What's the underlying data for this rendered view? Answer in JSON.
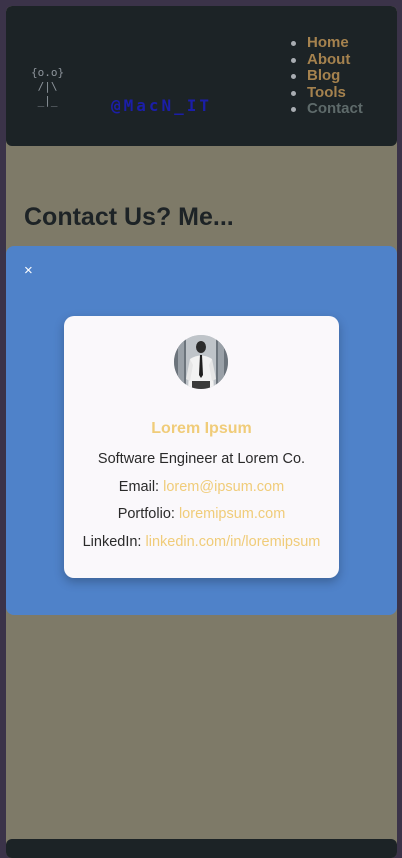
{
  "header": {
    "logo_art": "{o.o}\n /|\\\n _|_",
    "brand": "@MacN_IT",
    "nav": [
      {
        "label": "Home"
      },
      {
        "label": "About"
      },
      {
        "label": "Blog"
      },
      {
        "label": "Tools"
      },
      {
        "label": "Contact"
      }
    ]
  },
  "main": {
    "title": "Contact Us? Me..."
  },
  "modal": {
    "close_label": "×",
    "profile": {
      "name": "Lorem Ipsum",
      "role": "Software Engineer at Lorem Co.",
      "email_label": "Email:",
      "email": "lorem@ipsum.com",
      "portfolio_label": "Portfolio:",
      "portfolio": "loremipsum.com",
      "linkedin_label": "LinkedIn:",
      "linkedin": "linkedin.com/in/loremipsum"
    }
  },
  "colors": {
    "header_bg": "#1c2326",
    "page_bg": "#7e7a68",
    "modal_bg": "#4f82c9",
    "link": "#f0cc79",
    "nav_link": "#a5824e",
    "nav_active": "#5e6a6a",
    "brand": "#1b1ea8"
  }
}
